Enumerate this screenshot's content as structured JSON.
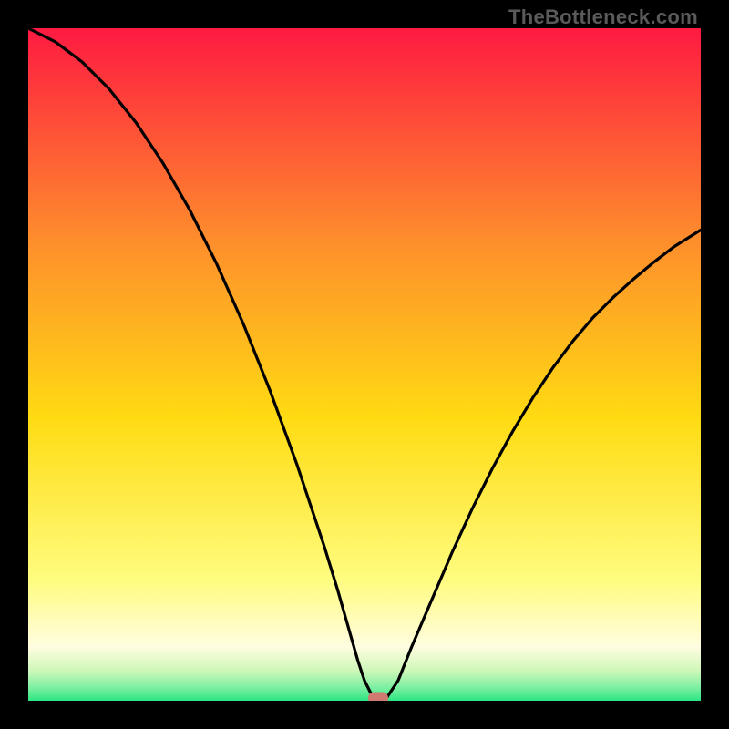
{
  "watermark": {
    "text": "TheBottleneck.com"
  },
  "colors": {
    "top": "#fe1a41",
    "mid_upper": "#fe8f2c",
    "mid": "#ffdb12",
    "mid_lower": "#fffc7f",
    "cream": "#fffde0",
    "pale_green": "#cff7b9",
    "green": "#2de582",
    "marker": "#cf7a71",
    "curve": "#000000"
  },
  "chart_data": {
    "type": "line",
    "title": "",
    "xlabel": "",
    "ylabel": "",
    "xlim": [
      0,
      100
    ],
    "ylim": [
      0,
      100
    ],
    "x": [
      0,
      2,
      4,
      6,
      8,
      10,
      12,
      14,
      16,
      18,
      20,
      22,
      24,
      26,
      28,
      30,
      32,
      34,
      36,
      38,
      40,
      42,
      44,
      46,
      47,
      48,
      49,
      50,
      51,
      52,
      53,
      55,
      57,
      60,
      63,
      66,
      69,
      72,
      75,
      78,
      81,
      84,
      87,
      90,
      93,
      96,
      100
    ],
    "values": [
      100,
      99,
      98,
      96.5,
      95,
      93,
      91,
      88.5,
      86,
      83,
      80,
      76.5,
      73,
      69,
      65,
      60.5,
      56,
      51,
      46,
      40.5,
      35,
      29,
      23,
      16.5,
      13,
      9.5,
      6,
      3,
      1,
      0,
      0,
      3,
      8,
      15,
      22,
      28.5,
      34.5,
      40,
      45,
      49.5,
      53.5,
      57,
      60,
      62.7,
      65.2,
      67.5,
      70
    ],
    "optimum_x": 52,
    "plateau": {
      "x_start": 47,
      "x_end": 53,
      "y": 0
    },
    "grid": false,
    "legend": null
  }
}
